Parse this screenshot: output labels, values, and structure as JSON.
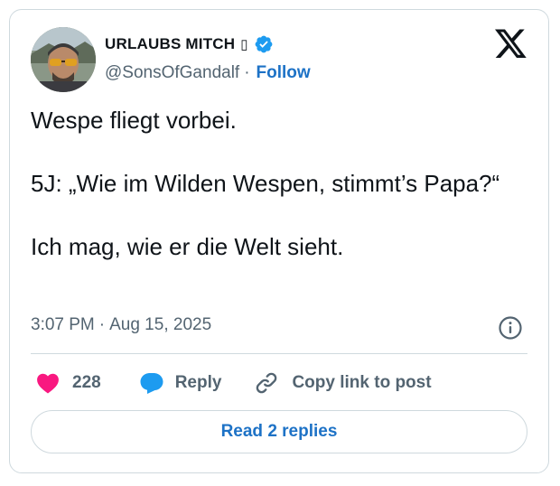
{
  "author": {
    "display_name": "URLAUBS MITCH",
    "name_glyph": "▯",
    "handle": "@SonsOfGandalf",
    "separator": "·",
    "follow_label": "Follow",
    "verified_color": "#1d9bf0"
  },
  "tweet": {
    "text": "Wespe fliegt vorbei.\n\n5J: „Wie im Wilden Wespen, stimmt’s Papa?“\n\nIch mag, wie er die Welt sieht.",
    "time": "3:07 PM",
    "separator": "·",
    "date": "Aug 15, 2025"
  },
  "actions": {
    "like_count": "228",
    "reply_label": "Reply",
    "copy_label": "Copy link to post",
    "like_color": "#f91880",
    "reply_color": "#1d9bf0"
  },
  "footer": {
    "read_replies_label": "Read 2 replies"
  },
  "icons": {
    "brand": "x-logo-icon",
    "info": "info-icon",
    "like": "heart-icon",
    "reply": "speech-bubble-icon",
    "copy": "link-icon",
    "verified": "verified-badge-icon"
  }
}
